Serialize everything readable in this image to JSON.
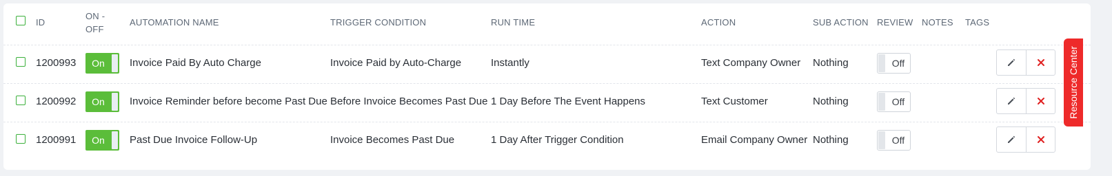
{
  "columns": {
    "id": "ID",
    "on_off_line1": "ON -",
    "on_off_line2": "OFF",
    "name": "AUTOMATION NAME",
    "trigger": "TRIGGER CONDITION",
    "run_time": "RUN TIME",
    "action": "ACTION",
    "sub_action": "SUB ACTION",
    "review": "REVIEW",
    "notes": "NOTES",
    "tags": "TAGS"
  },
  "rows": [
    {
      "id": "1200993",
      "toggle": "On",
      "name": "Invoice Paid By Auto Charge",
      "trigger": "Invoice Paid by Auto-Charge",
      "run_time": "Instantly",
      "action": "Text Company Owner",
      "sub_action": "Nothing",
      "review": "Off"
    },
    {
      "id": "1200992",
      "toggle": "On",
      "name": "Invoice Reminder before become Past Due",
      "trigger": "Before Invoice Becomes Past Due",
      "run_time": "1 Day Before The Event Happens",
      "action": "Text Customer",
      "sub_action": "Nothing",
      "review": "Off"
    },
    {
      "id": "1200991",
      "toggle": "On",
      "name": "Past Due Invoice Follow-Up",
      "trigger": "Invoice Becomes Past Due",
      "run_time": "1 Day After Trigger Condition",
      "action": "Email Company Owner",
      "sub_action": "Nothing",
      "review": "Off"
    }
  ],
  "resource_center": "Resource Center",
  "icons": {
    "edit": "pencil-icon",
    "delete": "close-icon"
  },
  "colors": {
    "toggle_on": "#5bbd3a",
    "delete": "#e02020",
    "resource_tab": "#ee2a2a",
    "checkbox": "#3bb03b"
  }
}
